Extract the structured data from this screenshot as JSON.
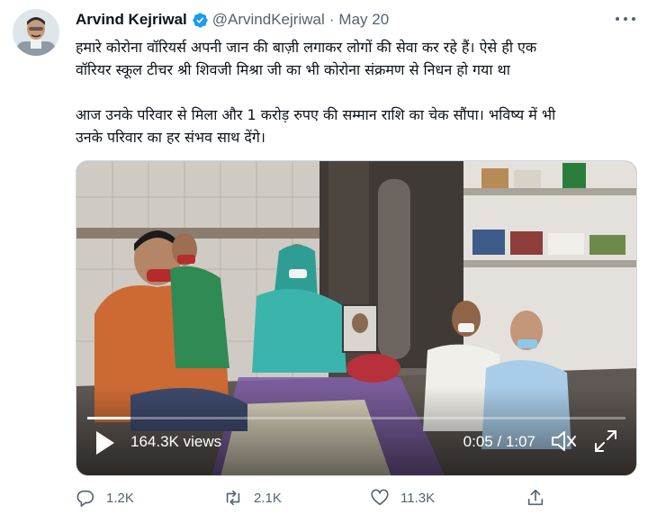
{
  "tweet": {
    "author_name": "Arvind Kejriwal",
    "handle": "@ArvindKejriwal",
    "separator": "·",
    "date": "May 20",
    "text_line1": "हमारे कोरोना वॉरियर्स अपनी जान की बाज़ी लगाकर लोगों की सेवा कर रहे हैं। ऐसे ही एक",
    "text_line2": "वॉरियर स्कूल टीचर श्री  शिवजी मिश्रा जी का भी कोरोना संक्रमण से निधन हो गया था",
    "text_line3": "आज उनके परिवार से मिला और 1 करोड़ रुपए की सम्मान राशि का चेक सौंपा। भविष्य में भी",
    "text_line4": "उनके परिवार का हर संभव साथ देंगे।"
  },
  "video": {
    "views": "164.3K views",
    "time": "0:05 / 1:07",
    "progress": 0.08
  },
  "actions": {
    "replies": "1.2K",
    "retweets": "2.1K",
    "likes": "11.3K"
  },
  "icons": {
    "verified": "verified-badge-icon",
    "more": "more-options-icon",
    "play": "play-icon",
    "volume": "volume-icon",
    "fullscreen": "fullscreen-icon",
    "reply": "reply-icon",
    "retweet": "retweet-icon",
    "like": "heart-icon",
    "share": "share-icon"
  },
  "colors": {
    "verified": "#1d9bf0",
    "muted_text": "#536471",
    "primary_text": "#0f1419"
  }
}
